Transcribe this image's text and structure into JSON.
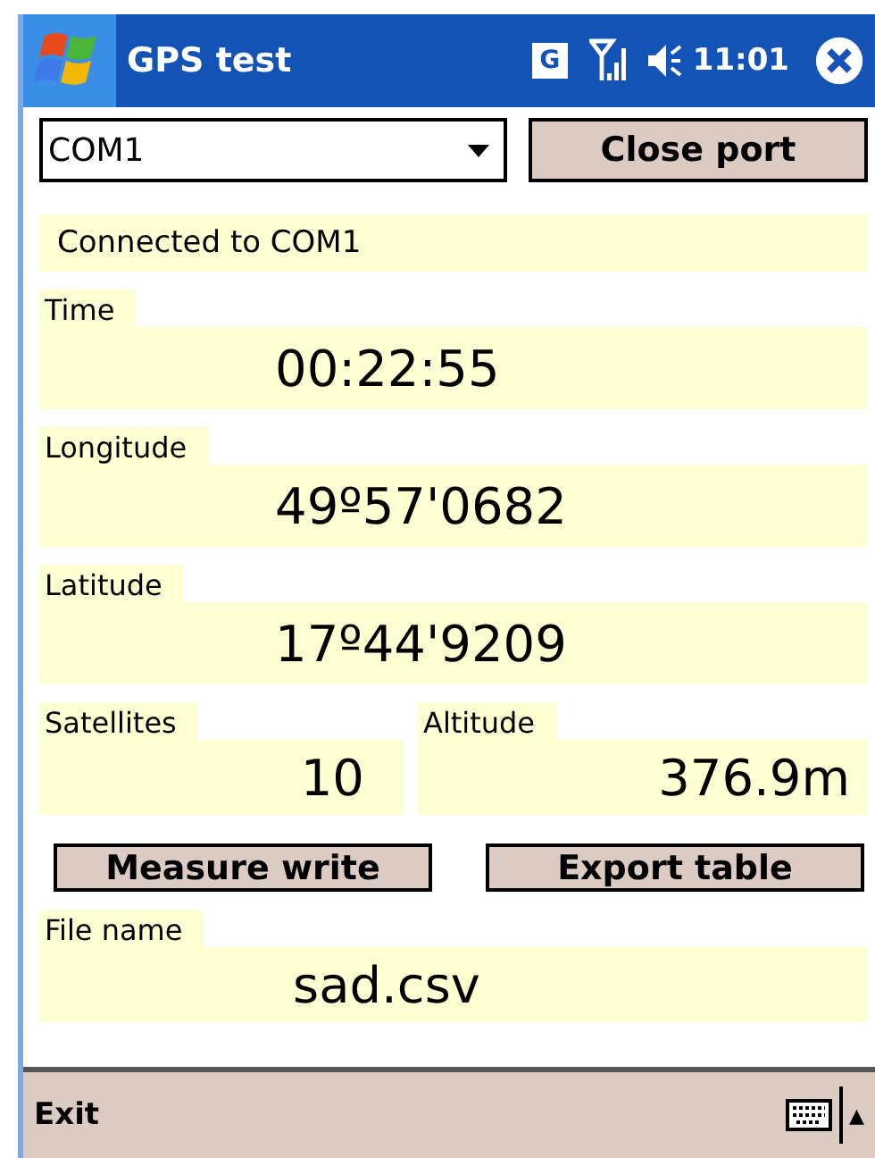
{
  "window": {
    "title": "GPS test"
  },
  "status_bar": {
    "badge": "G",
    "time": "11:01"
  },
  "port": {
    "value": "COM1"
  },
  "port_button": "Close port",
  "connection_status": "Connected to COM1",
  "readings": [
    {
      "label": "Time",
      "value": "00:22:55"
    },
    {
      "label": "Longitude",
      "value": "49º57'0682"
    },
    {
      "label": "Latitude",
      "value": "17º44'9209"
    }
  ],
  "pair": [
    {
      "label": "Satellites",
      "value": "10"
    },
    {
      "label": "Altitude",
      "value": "376.9m"
    }
  ],
  "buttons": [
    "Measure write",
    "Export table"
  ],
  "file": {
    "label": "File name",
    "value": "sad.csv"
  },
  "menu_bar": {
    "left": "Exit",
    "arrow": "▲"
  }
}
